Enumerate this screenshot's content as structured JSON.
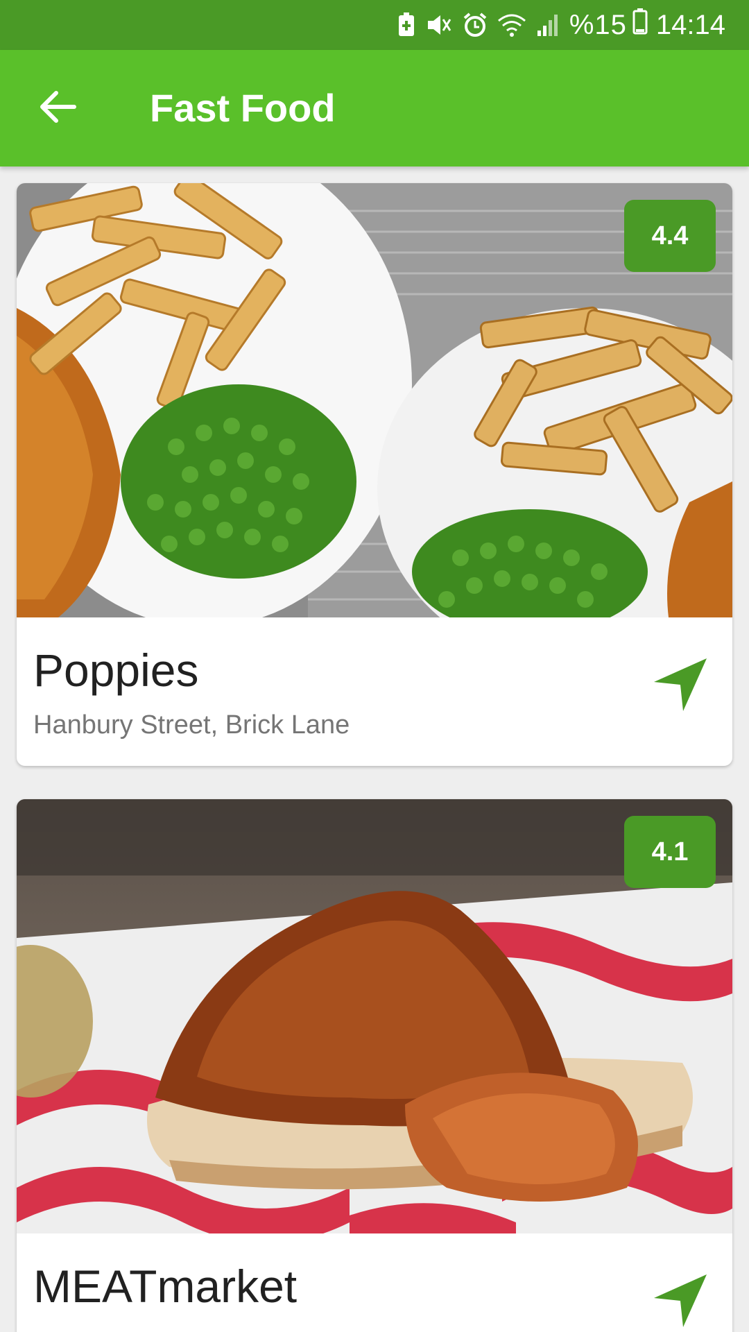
{
  "status_bar": {
    "battery_percent": "%15",
    "time": "14:14",
    "icons": [
      "battery-saver-icon",
      "mute-icon",
      "alarm-icon",
      "wifi-icon",
      "signal-icon",
      "battery-icon"
    ]
  },
  "app_bar": {
    "back_icon": "arrow-left-icon",
    "title": "Fast Food"
  },
  "restaurants": [
    {
      "name": "Poppies",
      "address": "Hanbury Street, Brick Lane",
      "rating": "4.4",
      "navigate_icon": "navigation-arrow-icon"
    },
    {
      "name": "MEATmarket",
      "address": "",
      "rating": "4.1",
      "navigate_icon": "navigation-arrow-icon"
    }
  ],
  "colors": {
    "status_bar": "#4a9a26",
    "app_bar": "#5ac02a",
    "accent": "#4a9a26",
    "background": "#eeeeee"
  }
}
